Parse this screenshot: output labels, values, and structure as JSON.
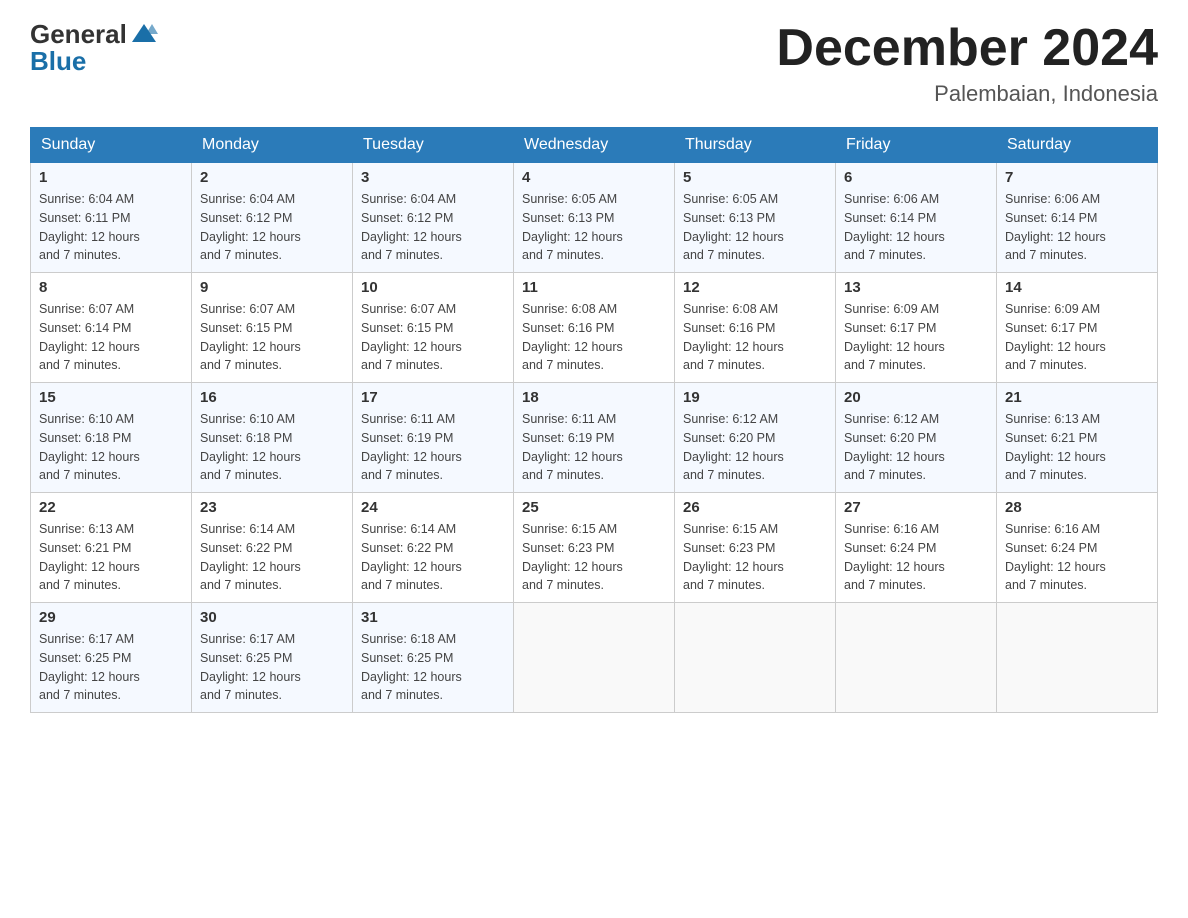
{
  "header": {
    "logo_general": "General",
    "logo_blue": "Blue",
    "calendar_title": "December 2024",
    "calendar_subtitle": "Palembaian, Indonesia"
  },
  "weekdays": [
    "Sunday",
    "Monday",
    "Tuesday",
    "Wednesday",
    "Thursday",
    "Friday",
    "Saturday"
  ],
  "weeks": [
    [
      {
        "day": "1",
        "sunrise": "6:04 AM",
        "sunset": "6:11 PM",
        "daylight": "12 hours and 7 minutes."
      },
      {
        "day": "2",
        "sunrise": "6:04 AM",
        "sunset": "6:12 PM",
        "daylight": "12 hours and 7 minutes."
      },
      {
        "day": "3",
        "sunrise": "6:04 AM",
        "sunset": "6:12 PM",
        "daylight": "12 hours and 7 minutes."
      },
      {
        "day": "4",
        "sunrise": "6:05 AM",
        "sunset": "6:13 PM",
        "daylight": "12 hours and 7 minutes."
      },
      {
        "day": "5",
        "sunrise": "6:05 AM",
        "sunset": "6:13 PM",
        "daylight": "12 hours and 7 minutes."
      },
      {
        "day": "6",
        "sunrise": "6:06 AM",
        "sunset": "6:14 PM",
        "daylight": "12 hours and 7 minutes."
      },
      {
        "day": "7",
        "sunrise": "6:06 AM",
        "sunset": "6:14 PM",
        "daylight": "12 hours and 7 minutes."
      }
    ],
    [
      {
        "day": "8",
        "sunrise": "6:07 AM",
        "sunset": "6:14 PM",
        "daylight": "12 hours and 7 minutes."
      },
      {
        "day": "9",
        "sunrise": "6:07 AM",
        "sunset": "6:15 PM",
        "daylight": "12 hours and 7 minutes."
      },
      {
        "day": "10",
        "sunrise": "6:07 AM",
        "sunset": "6:15 PM",
        "daylight": "12 hours and 7 minutes."
      },
      {
        "day": "11",
        "sunrise": "6:08 AM",
        "sunset": "6:16 PM",
        "daylight": "12 hours and 7 minutes."
      },
      {
        "day": "12",
        "sunrise": "6:08 AM",
        "sunset": "6:16 PM",
        "daylight": "12 hours and 7 minutes."
      },
      {
        "day": "13",
        "sunrise": "6:09 AM",
        "sunset": "6:17 PM",
        "daylight": "12 hours and 7 minutes."
      },
      {
        "day": "14",
        "sunrise": "6:09 AM",
        "sunset": "6:17 PM",
        "daylight": "12 hours and 7 minutes."
      }
    ],
    [
      {
        "day": "15",
        "sunrise": "6:10 AM",
        "sunset": "6:18 PM",
        "daylight": "12 hours and 7 minutes."
      },
      {
        "day": "16",
        "sunrise": "6:10 AM",
        "sunset": "6:18 PM",
        "daylight": "12 hours and 7 minutes."
      },
      {
        "day": "17",
        "sunrise": "6:11 AM",
        "sunset": "6:19 PM",
        "daylight": "12 hours and 7 minutes."
      },
      {
        "day": "18",
        "sunrise": "6:11 AM",
        "sunset": "6:19 PM",
        "daylight": "12 hours and 7 minutes."
      },
      {
        "day": "19",
        "sunrise": "6:12 AM",
        "sunset": "6:20 PM",
        "daylight": "12 hours and 7 minutes."
      },
      {
        "day": "20",
        "sunrise": "6:12 AM",
        "sunset": "6:20 PM",
        "daylight": "12 hours and 7 minutes."
      },
      {
        "day": "21",
        "sunrise": "6:13 AM",
        "sunset": "6:21 PM",
        "daylight": "12 hours and 7 minutes."
      }
    ],
    [
      {
        "day": "22",
        "sunrise": "6:13 AM",
        "sunset": "6:21 PM",
        "daylight": "12 hours and 7 minutes."
      },
      {
        "day": "23",
        "sunrise": "6:14 AM",
        "sunset": "6:22 PM",
        "daylight": "12 hours and 7 minutes."
      },
      {
        "day": "24",
        "sunrise": "6:14 AM",
        "sunset": "6:22 PM",
        "daylight": "12 hours and 7 minutes."
      },
      {
        "day": "25",
        "sunrise": "6:15 AM",
        "sunset": "6:23 PM",
        "daylight": "12 hours and 7 minutes."
      },
      {
        "day": "26",
        "sunrise": "6:15 AM",
        "sunset": "6:23 PM",
        "daylight": "12 hours and 7 minutes."
      },
      {
        "day": "27",
        "sunrise": "6:16 AM",
        "sunset": "6:24 PM",
        "daylight": "12 hours and 7 minutes."
      },
      {
        "day": "28",
        "sunrise": "6:16 AM",
        "sunset": "6:24 PM",
        "daylight": "12 hours and 7 minutes."
      }
    ],
    [
      {
        "day": "29",
        "sunrise": "6:17 AM",
        "sunset": "6:25 PM",
        "daylight": "12 hours and 7 minutes."
      },
      {
        "day": "30",
        "sunrise": "6:17 AM",
        "sunset": "6:25 PM",
        "daylight": "12 hours and 7 minutes."
      },
      {
        "day": "31",
        "sunrise": "6:18 AM",
        "sunset": "6:25 PM",
        "daylight": "12 hours and 7 minutes."
      },
      null,
      null,
      null,
      null
    ]
  ],
  "labels": {
    "sunrise": "Sunrise:",
    "sunset": "Sunset:",
    "daylight": "Daylight:"
  }
}
